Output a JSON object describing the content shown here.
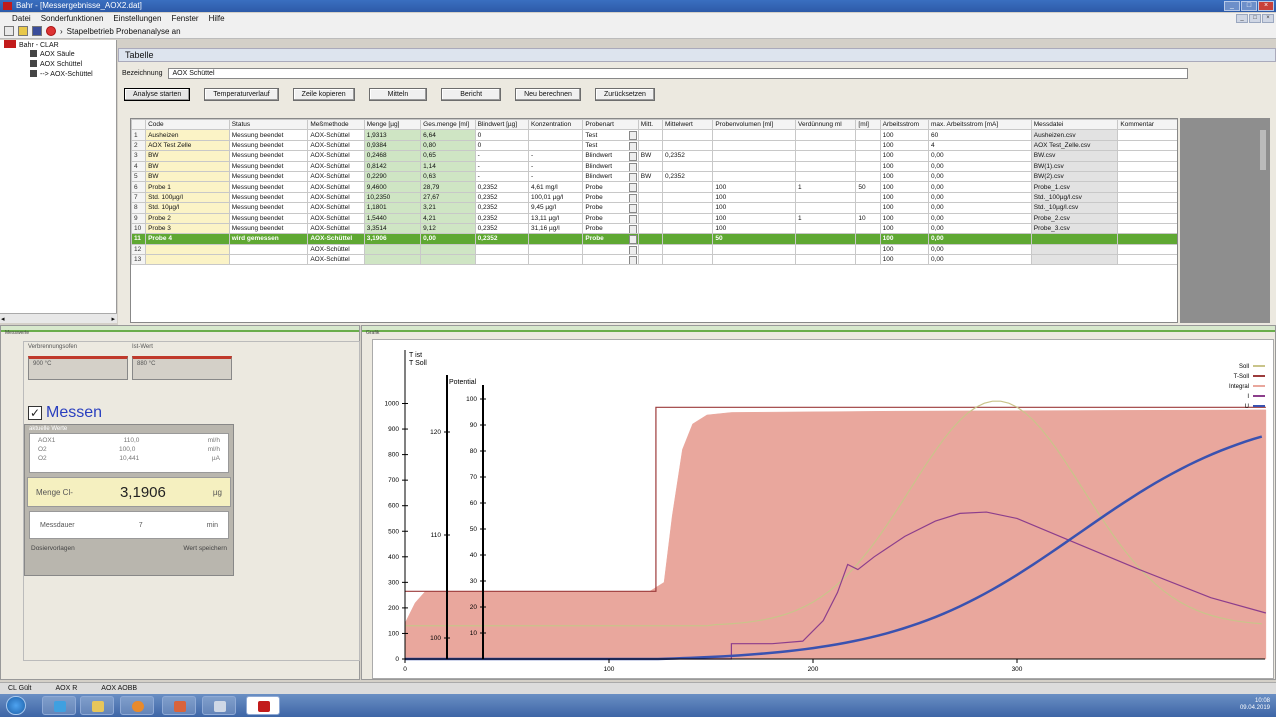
{
  "window": {
    "title": "Bahr - [Messergebnisse_AOX2.dat]"
  },
  "menu": [
    "Datei",
    "Sonderfunktionen",
    "Einstellungen",
    "Fenster",
    "Hilfe"
  ],
  "toolbar": {
    "label": "Stapelbetrieb Probenanalyse an"
  },
  "tree": {
    "root": "Bahr - CLAR",
    "items": [
      "AOX Säule",
      "AOX Schüttel",
      "--> AOX-Schüttel"
    ]
  },
  "table_panel": {
    "title": "Tabelle",
    "bez_label": "Bezeichnung",
    "bez_value": "AOX Schüttel",
    "buttons": [
      "Analyse starten",
      "Temperaturverlauf",
      "Zeile kopieren",
      "Mitteln",
      "Bericht",
      "Neu berechnen",
      "Zurücksetzen"
    ],
    "columns": [
      "",
      "Code",
      "Status",
      "Meßmethode",
      "Menge [µg]",
      "Ges.menge [ml]",
      "Blindwert [µg]",
      "Konzentration",
      "Probenart",
      "Mitt.",
      "Mittelwert",
      "Probenvolumen [ml]",
      "Verdünnung ml",
      "[ml]",
      "Arbeitsstrom",
      "max. Arbeitsstrom [mA]",
      "Messdatei",
      "Kommentar"
    ],
    "rows": [
      [
        "1",
        "Ausheizen",
        "Messung beendet",
        "AOX-Schüttel",
        "1,9313",
        "6,64",
        "0",
        "",
        "Test",
        "",
        "",
        "",
        "",
        "",
        "100",
        "60",
        "Ausheizen.csv",
        ""
      ],
      [
        "2",
        "AOX Test Zelle",
        "Messung beendet",
        "AOX-Schüttel",
        "0,9384",
        "0,80",
        "0",
        "",
        "Test",
        "",
        "",
        "",
        "",
        "",
        "100",
        "4",
        "AOX Test_Zelle.csv",
        ""
      ],
      [
        "3",
        "BW",
        "Messung beendet",
        "AOX-Schüttel",
        "0,2468",
        "0,65",
        "-",
        "-",
        "Blindwert",
        "BW",
        "0,2352",
        "",
        "",
        "",
        "100",
        "0,00",
        "BW.csv",
        ""
      ],
      [
        "4",
        "BW",
        "Messung beendet",
        "AOX-Schüttel",
        "0,8142",
        "1,14",
        "-",
        "-",
        "Blindwert",
        "",
        "",
        "",
        "",
        "",
        "100",
        "0,00",
        "BW(1).csv",
        ""
      ],
      [
        "5",
        "BW",
        "Messung beendet",
        "AOX-Schüttel",
        "0,2290",
        "0,63",
        "-",
        "-",
        "Blindwert",
        "BW",
        "0,2352",
        "",
        "",
        "",
        "100",
        "0,00",
        "BW(2).csv",
        ""
      ],
      [
        "6",
        "Probe 1",
        "Messung beendet",
        "AOX-Schüttel",
        "9,4600",
        "28,79",
        "0,2352",
        "4,61 mg/l",
        "Probe",
        "",
        "",
        "100",
        "1",
        "50",
        "100",
        "0,00",
        "Probe_1.csv",
        ""
      ],
      [
        "7",
        "Std. 100µg/l",
        "Messung beendet",
        "AOX-Schüttel",
        "10,2350",
        "27,67",
        "0,2352",
        "100,01 µg/l",
        "Probe",
        "",
        "",
        "100",
        "",
        "",
        "100",
        "0,00",
        "Std._100µg/l.csv",
        ""
      ],
      [
        "8",
        "Std. 10µg/l",
        "Messung beendet",
        "AOX-Schüttel",
        "1,1801",
        "3,21",
        "0,2352",
        "9,45 µg/l",
        "Probe",
        "",
        "",
        "100",
        "",
        "",
        "100",
        "0,00",
        "Std._10µg/l.csv",
        ""
      ],
      [
        "9",
        "Probe 2",
        "Messung beendet",
        "AOX-Schüttel",
        "1,5440",
        "4,21",
        "0,2352",
        "13,11 µg/l",
        "Probe",
        "",
        "",
        "100",
        "1",
        "10",
        "100",
        "0,00",
        "Probe_2.csv",
        ""
      ],
      [
        "10",
        "Probe 3",
        "Messung beendet",
        "AOX-Schüttel",
        "3,3514",
        "9,12",
        "0,2352",
        "31,16 µg/l",
        "Probe",
        "",
        "",
        "100",
        "",
        "",
        "100",
        "0,00",
        "Probe_3.csv",
        ""
      ],
      [
        "11",
        "Probe 4",
        "wird gemessen",
        "AOX-Schüttel",
        "3,1906",
        "0,00",
        "0,2352",
        "",
        "Probe",
        "",
        "",
        "50",
        "",
        "",
        "100",
        "0,00",
        "",
        ""
      ],
      [
        "12",
        "",
        "",
        "AOX-Schüttel",
        "",
        "",
        "",
        "",
        "",
        "",
        "",
        "",
        "",
        "",
        "100",
        "0,00",
        "",
        ""
      ],
      [
        "13",
        "",
        "",
        "AOX-Schüttel",
        "",
        "",
        "",
        "",
        "",
        "",
        "",
        "",
        "",
        "",
        "100",
        "0,00",
        "",
        ""
      ]
    ]
  },
  "measurement": {
    "panel_title": "Messwerte",
    "sensor1_label": "Verbrennungsofen",
    "sensor1_value": "900 °C",
    "sensor2_label": "Ist-Wert",
    "sensor2_value": "880 °C",
    "title": "Messen",
    "values_header": "aktuelle Werte",
    "values": [
      [
        "AOX1",
        "110,0",
        "ml/h"
      ],
      [
        "O2",
        "100,0",
        "ml/h"
      ],
      [
        "O2",
        "10,441",
        "µA"
      ]
    ],
    "menge_label": "Menge Cl-",
    "menge_value": "3,1906",
    "menge_unit": "µg",
    "mess_label": "Messdauer",
    "mess_value": "7",
    "mess_unit": "min",
    "foot_left": "Dosiervorlagen",
    "foot_right": "Wert speichern"
  },
  "graph": {
    "panel_title": "Grafik",
    "axis_left_title": "T ist",
    "axis_left_title2": "T Soll",
    "axis_pot_title": "Potential",
    "legend": [
      "Soll",
      "T-Soll",
      "Integral",
      "I",
      "U"
    ],
    "ticks_left": [
      "0",
      "100",
      "200",
      "300",
      "400",
      "500",
      "600",
      "700",
      "800",
      "900",
      "1000"
    ],
    "ticks_mid": [
      "100",
      "110",
      "120"
    ],
    "ticks_right": [
      "10",
      "20",
      "30",
      "40",
      "50",
      "60",
      "70",
      "80",
      "90",
      "100"
    ],
    "ticks_x": [
      "0",
      "100",
      "200",
      "300"
    ]
  },
  "statusbar": [
    "CL Gült",
    "AOX R",
    "AOX AOBB"
  ],
  "tray": {
    "time": "10:08",
    "date": "09.04.2019"
  }
}
